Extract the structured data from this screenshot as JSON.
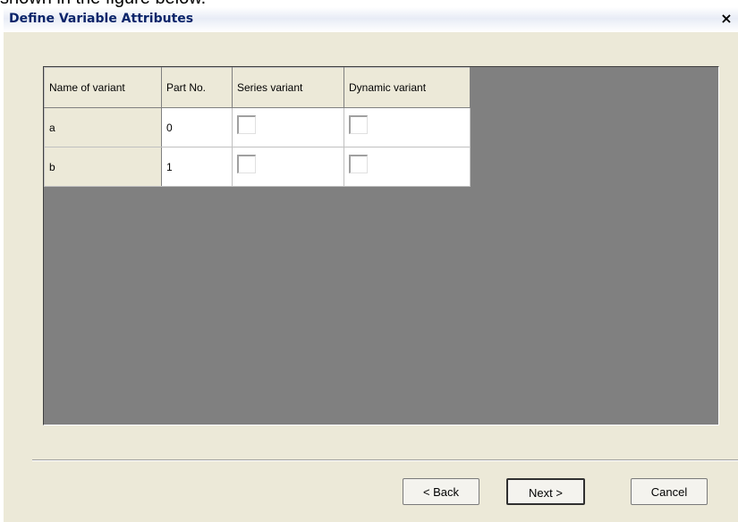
{
  "caption": "shown in the figure below.",
  "dialog": {
    "title": "Define Variable Attributes",
    "close_label": "×"
  },
  "grid": {
    "headers": [
      "Name of variant",
      "Part No.",
      "Series variant",
      "Dynamic variant"
    ],
    "rows": [
      {
        "name": "a",
        "part_no": "0",
        "series_variant": false,
        "dynamic_variant": false
      },
      {
        "name": "b",
        "part_no": "1",
        "series_variant": false,
        "dynamic_variant": false
      }
    ]
  },
  "buttons": {
    "back": "< Back",
    "next": "Next >",
    "cancel": "Cancel"
  }
}
